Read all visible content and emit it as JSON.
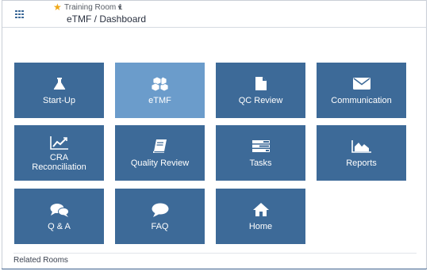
{
  "header": {
    "room_name": "Training Room 1",
    "page_title": "eTMF / Dashboard"
  },
  "tiles": [
    {
      "label": "Start-Up",
      "icon": "flask-icon"
    },
    {
      "label": "eTMF",
      "icon": "cubes-icon"
    },
    {
      "label": "QC Review",
      "icon": "file-icon"
    },
    {
      "label": "Communication",
      "icon": "envelope-icon"
    },
    {
      "label_line1": "CRA",
      "label_line2": "Reconciliation",
      "icon": "line-chart-icon"
    },
    {
      "label": "Quality Review",
      "icon": "book-icon"
    },
    {
      "label": "Tasks",
      "icon": "tasks-icon"
    },
    {
      "label": "Reports",
      "icon": "area-chart-icon"
    },
    {
      "label": "Q & A",
      "icon": "comments-icon"
    },
    {
      "label": "FAQ",
      "icon": "comment-icon"
    },
    {
      "label": "Home",
      "icon": "home-icon"
    }
  ],
  "footer": {
    "related_rooms": "Related Rooms"
  },
  "colors": {
    "tile": "#3d6a98",
    "tile_active": "#6b9ccb",
    "star": "#f0a818"
  }
}
